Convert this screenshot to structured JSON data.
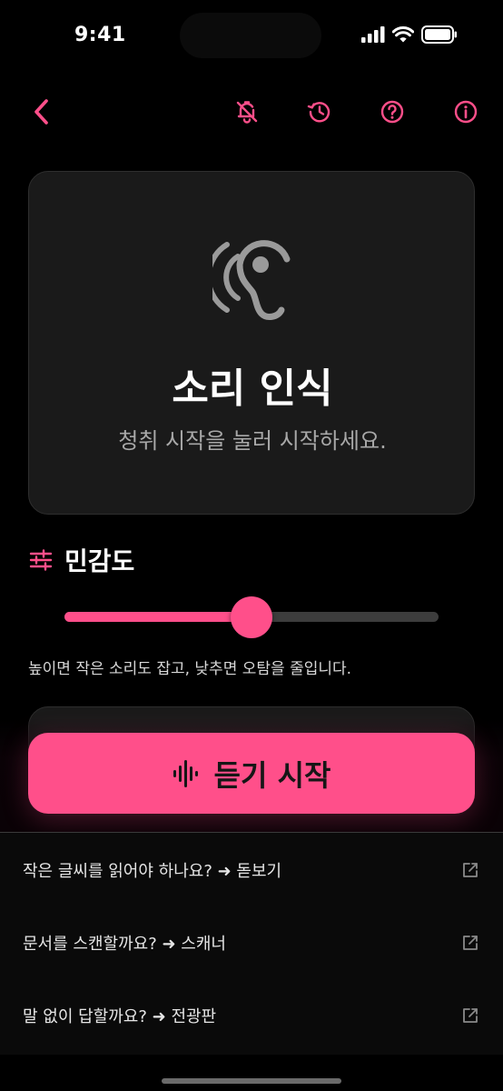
{
  "status": {
    "time": "9:41"
  },
  "colors": {
    "accent": "#ff4f8a",
    "card": "#1a1a1a",
    "text_muted": "#a8a8a8"
  },
  "topbar": {
    "icons": [
      "back-chevron-icon",
      "bell-off-icon",
      "history-icon",
      "help-circle-icon",
      "info-circle-icon"
    ]
  },
  "hero": {
    "icon": "ear-icon",
    "title": "소리 인식",
    "subtitle": "청취 시작을 눌러 시작하세요."
  },
  "sensitivity": {
    "icon": "sliders-icon",
    "label": "민감도",
    "value_fraction": 0.5,
    "hint": "높이면 작은 소리도 잡고, 낮추면 오탐을 줄입니다."
  },
  "listen_button": {
    "icon": "waveform-icon",
    "label": "듣기 시작"
  },
  "links": [
    {
      "text": "작은 글씨를 읽어야 하나요?  ➜  돋보기",
      "icon": "external-link-icon"
    },
    {
      "text": "문서를 스캔할까요?  ➜  스캐너",
      "icon": "external-link-icon"
    },
    {
      "text": "말 없이 답할까요?  ➜  전광판",
      "icon": "external-link-icon"
    }
  ]
}
